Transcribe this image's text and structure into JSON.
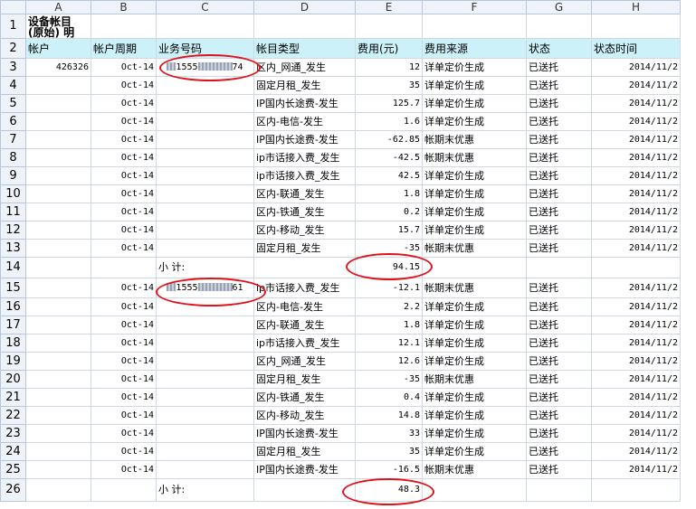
{
  "columns": [
    "A",
    "B",
    "C",
    "D",
    "E",
    "F",
    "G",
    "H"
  ],
  "title_line1": "设备帐目",
  "title_line2": "(原始) 明",
  "headers": {
    "account": "帐户",
    "cycle": "帐户周期",
    "service_number": "业务号码",
    "item_type": "帐目类型",
    "fee": "费用(元)",
    "fee_source": "费用来源",
    "status": "状态",
    "status_time": "状态时间"
  },
  "account_id": "426326",
  "group1_number": {
    "prefix": "1555",
    "suffix": "74"
  },
  "group2_number": {
    "prefix": "1555",
    "suffix": "61"
  },
  "subtotal_label": "小 计:",
  "rows": [
    {
      "n": "3",
      "b": "Oct-14",
      "d": "区内_网通_发生",
      "e": "12",
      "f": "详单定价生成",
      "g": "已送托",
      "h": "2014/11/2"
    },
    {
      "n": "4",
      "b": "Oct-14",
      "d": "固定月租_发生",
      "e": "35",
      "f": "详单定价生成",
      "g": "已送托",
      "h": "2014/11/2"
    },
    {
      "n": "5",
      "b": "Oct-14",
      "d": "IP国内长途费-发生",
      "e": "125.7",
      "f": "详单定价生成",
      "g": "已送托",
      "h": "2014/11/2"
    },
    {
      "n": "6",
      "b": "Oct-14",
      "d": "区内-电信-发生",
      "e": "1.6",
      "f": "详单定价生成",
      "g": "已送托",
      "h": "2014/11/2"
    },
    {
      "n": "7",
      "b": "Oct-14",
      "d": "IP国内长途费-发生",
      "e": "-62.85",
      "f": "帐期末优惠",
      "g": "已送托",
      "h": "2014/11/2"
    },
    {
      "n": "8",
      "b": "Oct-14",
      "d": "ip市话接入费_发生",
      "e": "-42.5",
      "f": "帐期末优惠",
      "g": "已送托",
      "h": "2014/11/2"
    },
    {
      "n": "9",
      "b": "Oct-14",
      "d": "ip市话接入费_发生",
      "e": "42.5",
      "f": "详单定价生成",
      "g": "已送托",
      "h": "2014/11/2"
    },
    {
      "n": "10",
      "b": "Oct-14",
      "d": "区内-联通_发生",
      "e": "1.8",
      "f": "详单定价生成",
      "g": "已送托",
      "h": "2014/11/2"
    },
    {
      "n": "11",
      "b": "Oct-14",
      "d": "区内-铁通_发生",
      "e": "0.2",
      "f": "详单定价生成",
      "g": "已送托",
      "h": "2014/11/2"
    },
    {
      "n": "12",
      "b": "Oct-14",
      "d": "区内-移动_发生",
      "e": "15.7",
      "f": "详单定价生成",
      "g": "已送托",
      "h": "2014/11/2"
    },
    {
      "n": "13",
      "b": "Oct-14",
      "d": "固定月租_发生",
      "e": "-35",
      "f": "帐期末优惠",
      "g": "已送托",
      "h": "2014/11/2"
    },
    {
      "n": "14",
      "subtotal": "94.15"
    },
    {
      "n": "15",
      "b": "Oct-14",
      "d": "ip市话接入费_发生",
      "e": "-12.1",
      "f": "帐期末优惠",
      "g": "已送托",
      "h": "2014/11/2"
    },
    {
      "n": "16",
      "b": "Oct-14",
      "d": "区内-电信-发生",
      "e": "2.2",
      "f": "详单定价生成",
      "g": "已送托",
      "h": "2014/11/2"
    },
    {
      "n": "17",
      "b": "Oct-14",
      "d": "区内-联通_发生",
      "e": "1.8",
      "f": "详单定价生成",
      "g": "已送托",
      "h": "2014/11/2"
    },
    {
      "n": "18",
      "b": "Oct-14",
      "d": "ip市话接入费_发生",
      "e": "12.1",
      "f": "详单定价生成",
      "g": "已送托",
      "h": "2014/11/2"
    },
    {
      "n": "19",
      "b": "Oct-14",
      "d": "区内_网通_发生",
      "e": "12.6",
      "f": "详单定价生成",
      "g": "已送托",
      "h": "2014/11/2"
    },
    {
      "n": "20",
      "b": "Oct-14",
      "d": "固定月租_发生",
      "e": "-35",
      "f": "帐期末优惠",
      "g": "已送托",
      "h": "2014/11/2"
    },
    {
      "n": "21",
      "b": "Oct-14",
      "d": "区内-铁通_发生",
      "e": "0.4",
      "f": "详单定价生成",
      "g": "已送托",
      "h": "2014/11/2"
    },
    {
      "n": "22",
      "b": "Oct-14",
      "d": "区内-移动_发生",
      "e": "14.8",
      "f": "详单定价生成",
      "g": "已送托",
      "h": "2014/11/2"
    },
    {
      "n": "23",
      "b": "Oct-14",
      "d": "IP国内长途费-发生",
      "e": "33",
      "f": "详单定价生成",
      "g": "已送托",
      "h": "2014/11/2"
    },
    {
      "n": "24",
      "b": "Oct-14",
      "d": "固定月租_发生",
      "e": "35",
      "f": "详单定价生成",
      "g": "已送托",
      "h": "2014/11/2"
    },
    {
      "n": "25",
      "b": "Oct-14",
      "d": "IP国内长途费-发生",
      "e": "-16.5",
      "f": "帐期末优惠",
      "g": "已送托",
      "h": "2014/11/2"
    },
    {
      "n": "26",
      "subtotal": "48.3"
    }
  ],
  "annotation_color": "#e0121b"
}
